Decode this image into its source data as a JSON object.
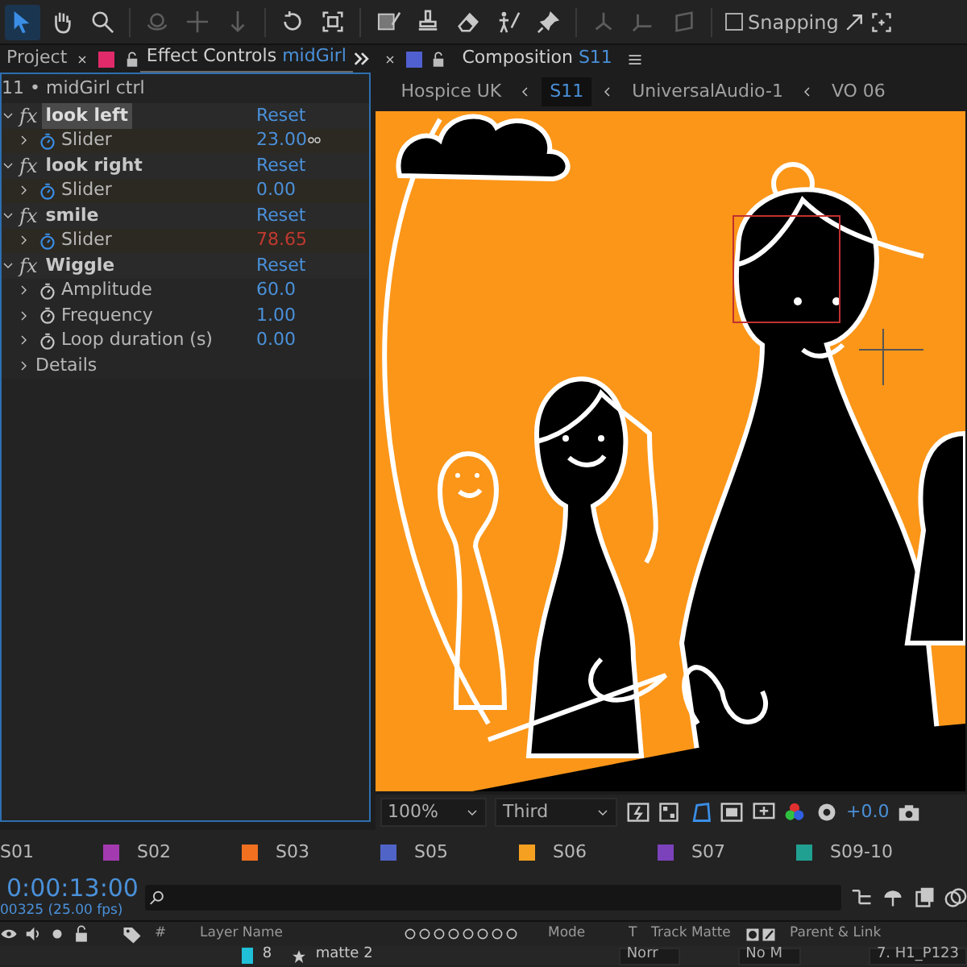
{
  "toolbar": {
    "tools": [
      {
        "selected": true,
        "disabled": false
      },
      {
        "selected": false,
        "disabled": false
      },
      {
        "selected": false,
        "disabled": false
      },
      {
        "selected": false,
        "disabled": true
      },
      {
        "selected": false,
        "disabled": true
      },
      {
        "selected": false,
        "disabled": true
      },
      {
        "selected": false,
        "disabled": false
      },
      {
        "selected": false,
        "disabled": false
      },
      {
        "selected": false,
        "disabled": false
      },
      {
        "selected": false,
        "disabled": false
      },
      {
        "selected": false,
        "disabled": false
      },
      {
        "selected": false,
        "disabled": false
      },
      {
        "selected": false,
        "disabled": false
      },
      {
        "selected": false,
        "disabled": true
      },
      {
        "selected": false,
        "disabled": true
      },
      {
        "selected": false,
        "disabled": true
      }
    ],
    "snapping": {
      "label": "Snapping",
      "checked": false
    }
  },
  "left_panel": {
    "tabs": [
      {
        "label": "Project",
        "selected": false
      },
      {
        "label": "Effect Controls",
        "target": "midGirl",
        "selected": true
      }
    ],
    "layer_title": "11 • midGirl ctrl",
    "effects": [
      {
        "badge": "fx",
        "name": "look left",
        "selected": true,
        "expanded": true,
        "reset": "Reset",
        "properties": [
          {
            "name": "Slider",
            "value": "23.00",
            "animated": true,
            "expression": false
          }
        ]
      },
      {
        "badge": "fx",
        "name": "look right",
        "selected": false,
        "expanded": true,
        "reset": "Reset",
        "properties": [
          {
            "name": "Slider",
            "value": "0.00",
            "animated": true,
            "expression": false
          }
        ]
      },
      {
        "badge": "fx",
        "name": "smile",
        "selected": false,
        "expanded": true,
        "reset": "Reset",
        "properties": [
          {
            "name": "Slider",
            "value": "78.65",
            "animated": true,
            "expression": true
          }
        ]
      },
      {
        "badge": "fx",
        "name": "Wiggle",
        "selected": false,
        "expanded": true,
        "reset": "Reset",
        "properties": [
          {
            "name": "Amplitude",
            "value": "60.0",
            "animated": false,
            "expression": false
          },
          {
            "name": "Frequency",
            "value": "1.00",
            "animated": false,
            "expression": false
          },
          {
            "name": "Loop duration (s)",
            "value": "0.00",
            "animated": false,
            "expression": false
          }
        ]
      }
    ],
    "details": "Details"
  },
  "composition": {
    "tab_label": "Composition",
    "comp_name": "S11",
    "breadcrumbs": [
      {
        "label": "Hospice UK",
        "selected": false
      },
      {
        "label": "S11",
        "selected": true
      },
      {
        "label": "UniversalAudio-1",
        "selected": false
      },
      {
        "label": "VO 06",
        "selected": false
      }
    ],
    "viewer_bar": {
      "zoom": "100%",
      "resolution": "Third",
      "exposure": "+0.0"
    }
  },
  "timeline": {
    "comp_tabs": [
      {
        "label": "S01"
      },
      {
        "label": "S02",
        "color": "#a43ab0"
      },
      {
        "label": "S03",
        "color": "#f07020"
      },
      {
        "label": "S05",
        "color": "#5064c8"
      },
      {
        "label": "S06",
        "color": "#f5a020"
      },
      {
        "label": "S07",
        "color": "#7c42bc"
      },
      {
        "label": "S09-10",
        "color": "#20a090"
      }
    ],
    "timecode": "0:00:13:00",
    "frame": "00325 (25.00 fps)",
    "columns": {
      "number": "#",
      "layer_name": "Layer Name",
      "mode": "Mode",
      "t": "T",
      "track_matte": "Track Matte",
      "parent": "Parent & Link"
    },
    "layers": [
      {
        "number": "8",
        "name": "matte 2",
        "color": "#20c0d8",
        "mode": "Norr",
        "track_matte": "No M",
        "parent": "7. H1_P123"
      }
    ]
  }
}
